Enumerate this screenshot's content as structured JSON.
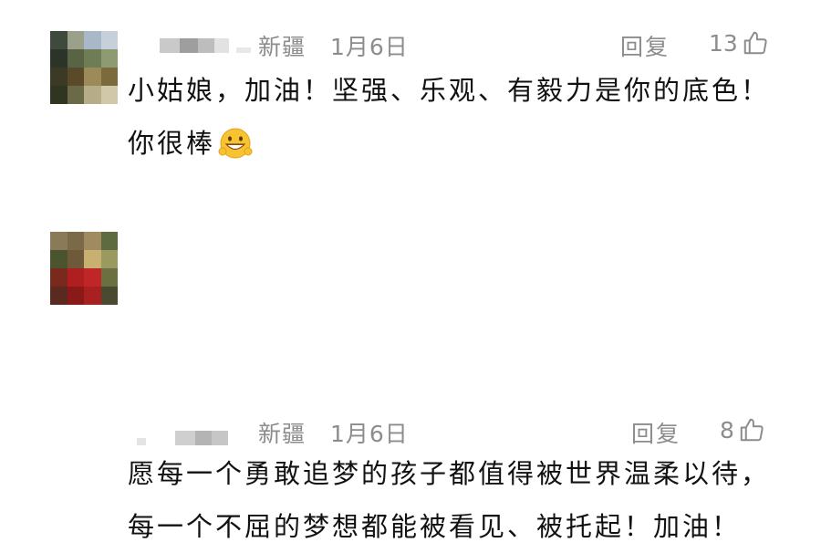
{
  "comments": [
    {
      "region": "新疆",
      "date": "1月6日",
      "reply_label": "回复",
      "likes": "13",
      "text": "小姑娘，加油！坚强、乐观、有毅力是你的底色！你很棒",
      "emoji": "grinning-face-emoji"
    },
    {
      "region": "新疆",
      "date": "1月6日",
      "reply_label": "回复",
      "likes": "8",
      "text": "愿每一个勇敢追梦的孩子都值得被世界温柔以待，每一个不屈的梦想都能被看见、被托起！加油！"
    }
  ],
  "icons": {
    "like": "thumbs-up-outline-icon"
  },
  "colors": {
    "meta_text": "#8c8c8c",
    "body_text": "#111111"
  }
}
